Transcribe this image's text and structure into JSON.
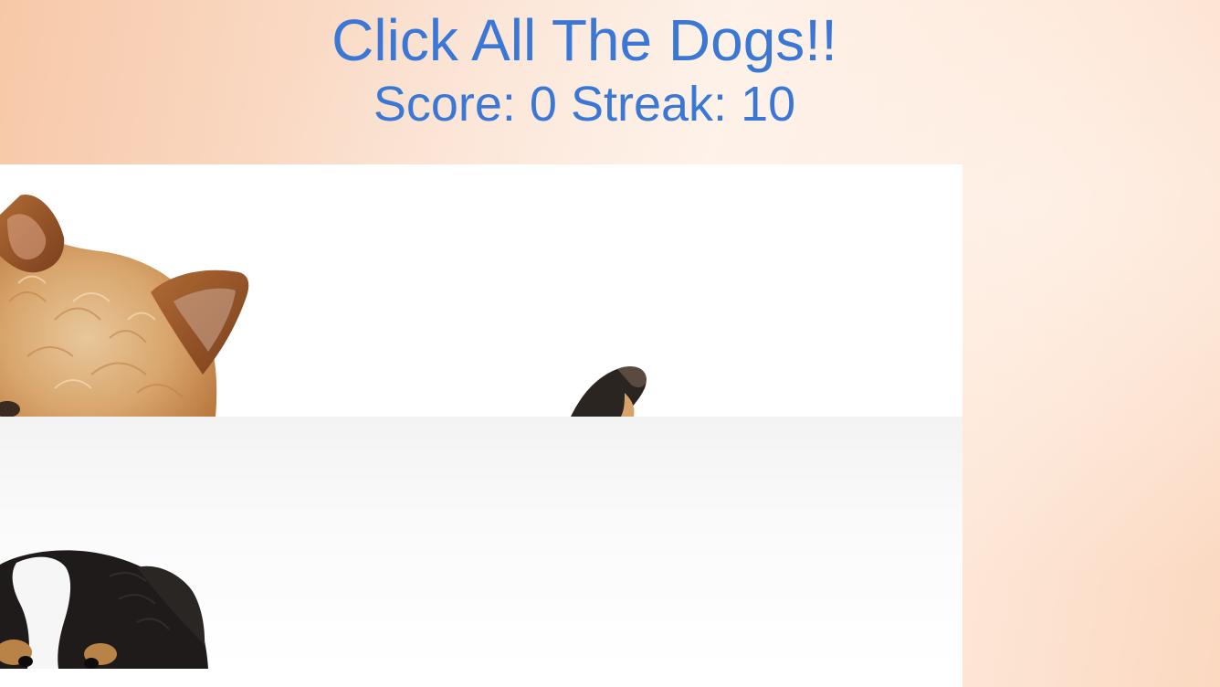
{
  "game": {
    "title": "Click All The Dogs!!",
    "score_label": "Score:",
    "score": "0",
    "streak_label": "Streak:",
    "streak": "10"
  },
  "colors": {
    "accent": "#3b78d6",
    "background_peach": "#fbe2d2"
  },
  "tiles": [
    {
      "subject": "terrier-dog-photo"
    },
    {
      "subject": "border-collie-dog-photo"
    }
  ]
}
